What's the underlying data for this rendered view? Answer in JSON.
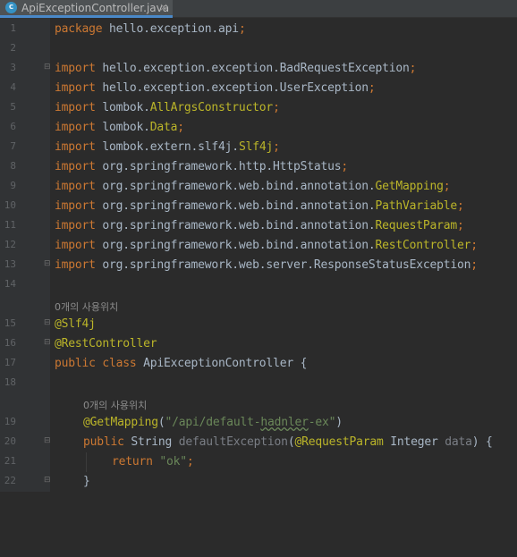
{
  "tab": {
    "icon_letter": "c",
    "title": "ApiExceptionController.java",
    "close": "×"
  },
  "gutter": {
    "line_numbers": [
      "1",
      "2",
      "3",
      "4",
      "5",
      "6",
      "7",
      "8",
      "9",
      "10",
      "11",
      "12",
      "13",
      "14",
      "15",
      "16",
      "17",
      "18",
      "19",
      "20",
      "21",
      "22"
    ]
  },
  "hints": {
    "usage_class": "0개의 사용위치",
    "usage_method": "0개의 사용위치"
  },
  "code": {
    "l1": {
      "kw": "package",
      "rest": " hello.exception.api",
      "semi": ";"
    },
    "imp": "import",
    "l3": {
      "pkg": " hello.exception.exception.BadRequestException",
      "semi": ";"
    },
    "l4": {
      "pkg": " hello.exception.exception.UserException",
      "semi": ";"
    },
    "l5": {
      "pkg": " lombok.",
      "name": "AllArgsConstructor",
      "semi": ";"
    },
    "l6": {
      "pkg": " lombok.",
      "name": "Data",
      "semi": ";"
    },
    "l7": {
      "pkg": " lombok.extern.slf4j.",
      "name": "Slf4j",
      "semi": ";"
    },
    "l8": {
      "pkg": " org.springframework.http.HttpStatus",
      "semi": ";"
    },
    "l9": {
      "pkg": " org.springframework.web.bind.annotation.",
      "name": "GetMapping",
      "semi": ";"
    },
    "l10": {
      "pkg": " org.springframework.web.bind.annotation.",
      "name": "PathVariable",
      "semi": ";"
    },
    "l11": {
      "pkg": " org.springframework.web.bind.annotation.",
      "name": "RequestParam",
      "semi": ";"
    },
    "l12": {
      "pkg": " org.springframework.web.bind.annotation.",
      "name": "RestController",
      "semi": ";"
    },
    "l13": {
      "pkg": " org.springframework.web.server.ResponseStatusException",
      "semi": ";"
    },
    "l15": {
      "ann": "@Slf4j"
    },
    "l16": {
      "ann": "@RestController"
    },
    "l17": {
      "kw": "public class",
      "rest": " ApiExceptionController {"
    },
    "l19": {
      "ann": "@GetMapping",
      "open": "(",
      "str_a": "\"/api/default-",
      "str_b": "hadnler",
      "str_c": "-ex\"",
      "close": ")"
    },
    "l20": {
      "kw": "public",
      "t1": " String ",
      "method": "defaultException",
      "p1": "(",
      "ann": "@RequestParam",
      "t2": " Integer ",
      "param": "data",
      "t3": ") {"
    },
    "l21": {
      "kw": "return",
      "sp": " ",
      "str": "\"ok\"",
      "semi": ";"
    },
    "l22": {
      "brace": "}"
    }
  }
}
